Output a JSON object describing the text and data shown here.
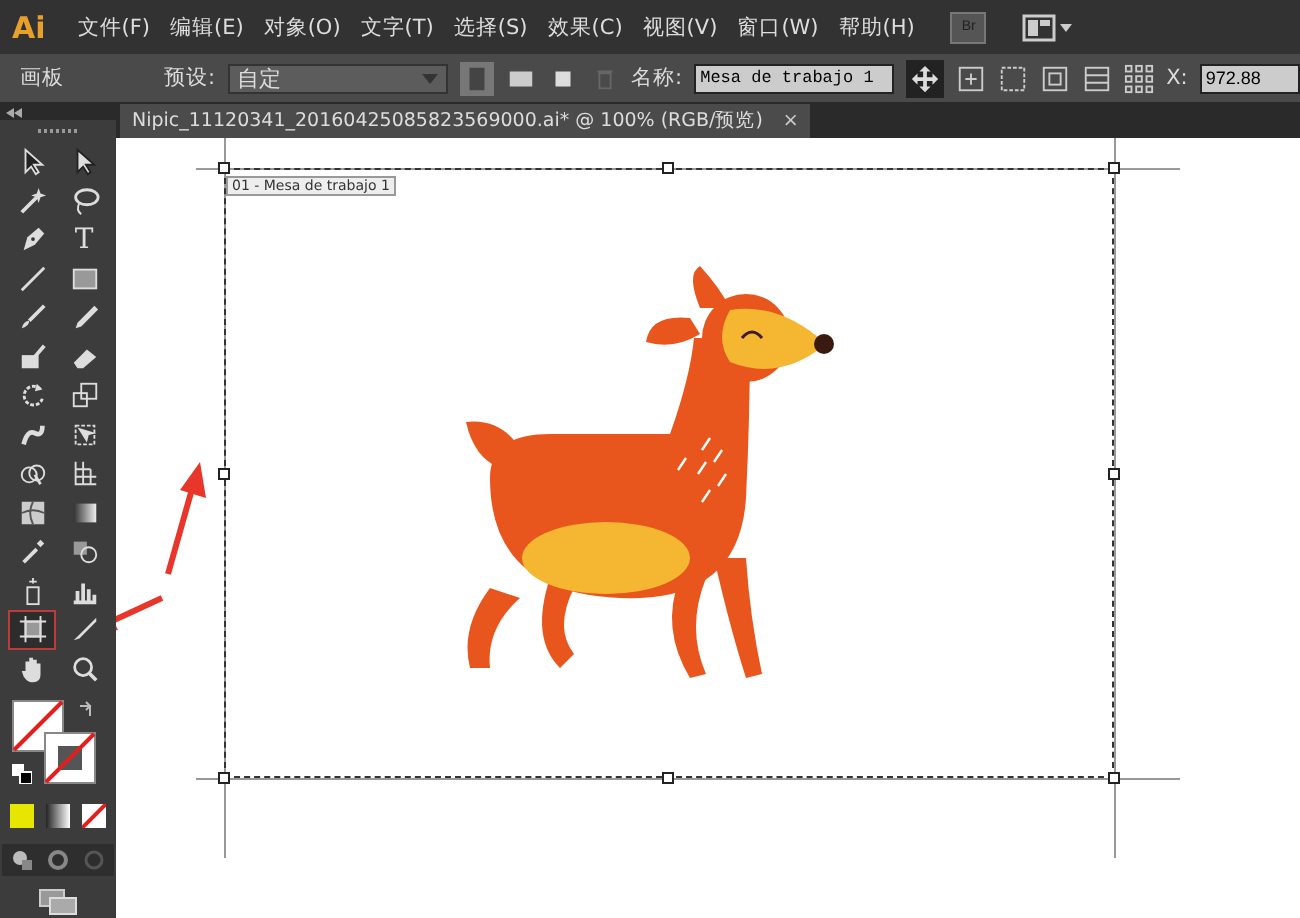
{
  "menu_bar": {
    "logo": "Ai",
    "items": [
      "文件(F)",
      "编辑(E)",
      "对象(O)",
      "文字(T)",
      "选择(S)",
      "效果(C)",
      "视图(V)",
      "窗口(W)",
      "帮助(H)"
    ],
    "bridge": "Br"
  },
  "control_bar": {
    "panel_label": "画板",
    "preset_label": "预设:",
    "preset_value": "自定",
    "name_label": "名称:",
    "name_value": "Mesa de trabajo 1",
    "x_label": "X:",
    "x_value": "972.88"
  },
  "document_tab": {
    "title": "Nipic_11120341_20160425085823569000.ai*  @  100%  (RGB/预览)",
    "close": "×"
  },
  "tools": [
    {
      "kind": "selection",
      "selected": false
    },
    {
      "kind": "direct",
      "selected": false
    },
    {
      "kind": "wand",
      "selected": false
    },
    {
      "kind": "lasso",
      "selected": false
    },
    {
      "kind": "pen",
      "selected": false
    },
    {
      "kind": "type",
      "glyph": "T",
      "selected": false
    },
    {
      "kind": "line",
      "selected": false
    },
    {
      "kind": "rect",
      "selected": false
    },
    {
      "kind": "brush",
      "selected": false
    },
    {
      "kind": "pencil",
      "selected": false
    },
    {
      "kind": "blob",
      "selected": false
    },
    {
      "kind": "eraser",
      "selected": false
    },
    {
      "kind": "rotate",
      "selected": false
    },
    {
      "kind": "scale",
      "selected": false
    },
    {
      "kind": "warp",
      "selected": false
    },
    {
      "kind": "transform",
      "selected": false
    },
    {
      "kind": "builder",
      "selected": false
    },
    {
      "kind": "grid",
      "selected": false
    },
    {
      "kind": "mesh",
      "selected": false
    },
    {
      "kind": "gradient",
      "selected": false
    },
    {
      "kind": "dropper",
      "selected": false
    },
    {
      "kind": "blend",
      "selected": false
    },
    {
      "kind": "spray",
      "selected": false
    },
    {
      "kind": "graph",
      "selected": false
    },
    {
      "kind": "artboard",
      "selected": true
    },
    {
      "kind": "slice",
      "selected": false
    },
    {
      "kind": "hand",
      "selected": false
    },
    {
      "kind": "zoom",
      "selected": false
    }
  ],
  "artboard": {
    "label": "01 - Mesa de trabajo 1"
  }
}
